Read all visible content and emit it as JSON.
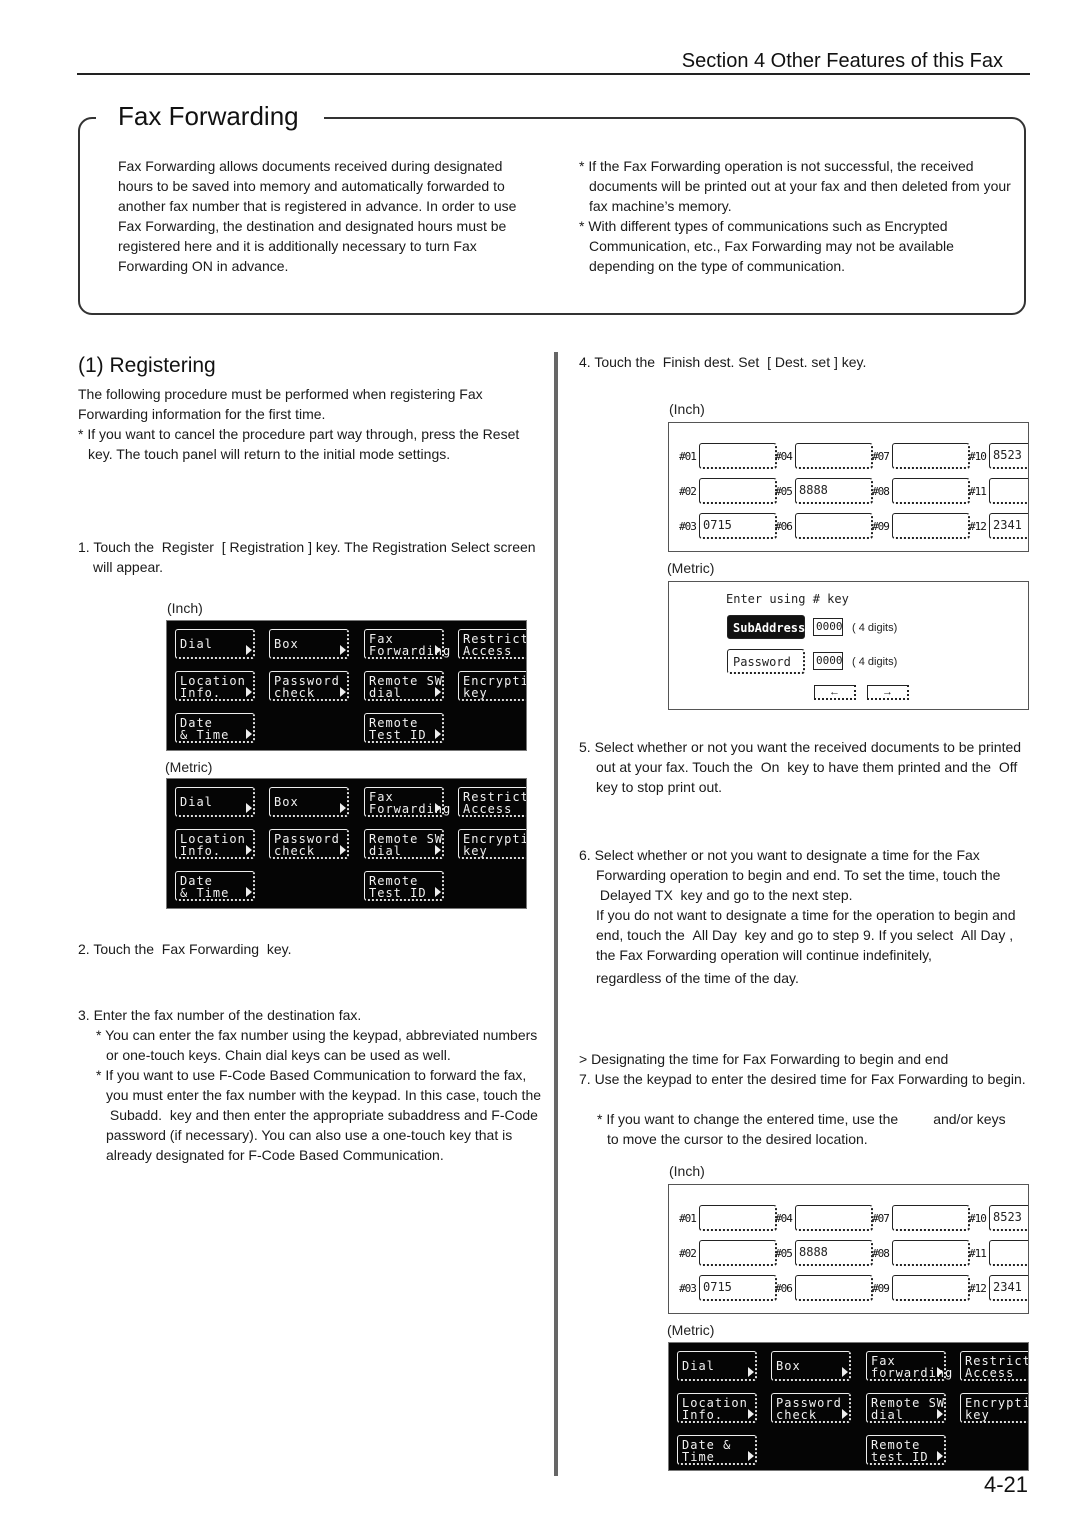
{
  "header": {
    "section_title": "Section 4 Other Features of this Fax"
  },
  "intro": {
    "title": "Fax Forwarding",
    "left_text": "Fax Forwarding allows documents received during designated hours to be saved into memory and automatically forwarded to another fax number that is registered in advance. In order to use Fax Forwarding, the destination and designated hours must be registered here and it is additionally necessary to turn Fax Forwarding ON in advance.",
    "notes": [
      "* If the Fax Forwarding operation is not successful, the received documents will be printed out at your fax and then deleted from your fax machine’s memory.",
      "* With different types of communications such as Encrypted Communication, etc., Fax Forwarding may not be available depending on the type of communication."
    ]
  },
  "registering": {
    "heading": "(1) Registering",
    "lead": "The following procedure must be performed when registering Fax Forwarding information for the first time.",
    "cancel_note": "* If you want to cancel the procedure part way through, press the Reset key. The touch panel will return to the initial mode settings.",
    "step1": "1. Touch the  Register  [ Registration ] key. The Registration Select screen will appear.",
    "step2": "2. Touch the  Fax Forwarding  key.",
    "step3": "3. Enter the fax number of the destination fax.",
    "step3_notes": [
      "* You can enter the fax number using the keypad, abbreviated numbers or one-touch keys. Chain dial keys can be used as well.",
      "* If you want to use F-Code Based Communication to forward the fax, you must enter the fax number with the keypad. In this case, touch the  Subadd.  key and then enter the appropriate subaddress and F-Code password (if necessary). You can also use a one-touch key that is already designated for F-Code Based Communication."
    ],
    "step4": "4. Touch the  Finish dest. Set  [ Dest. set ] key.",
    "step5": "5. Select whether or not you want the received documents to be printed out at your fax. Touch the  On  key to have them printed and the  Off  key to stop print out.",
    "step6a": "6. Select whether or not you want to designate a time for the Fax Forwarding operation to begin and end. To set the time, touch the  Delayed TX  key and go to the next step.",
    "step6b": "If you do not want to designate a time for the operation to begin and end, touch the  All Day  key and go to step 9. If you select  All Day , the Fax Forwarding operation will continue indefinitely,",
    "step6c": "regardless of the time of the day.",
    "subheading": "> Designating the time for Fax Forwarding to begin and end",
    "step7": "7. Use the keypad to enter the desired time for Fax Forwarding to begin.",
    "step7_note": "* If you want to change the entered time, use the         and/or keys to move the cursor to the desired location."
  },
  "captions": {
    "inch": "(Inch)",
    "metric": "(Metric)"
  },
  "menu_inch": [
    {
      "label": "Dial"
    },
    {
      "label": "Box"
    },
    {
      "label": "Fax\nForwarding"
    },
    {
      "label": "Restricted\nAccess"
    },
    {
      "label": "Location\nInfo."
    },
    {
      "label": "Password\ncheck"
    },
    {
      "label": "Remote SW\ndial"
    },
    {
      "label": "Encryption\nkey"
    },
    {
      "label": "Date\n& Time"
    },
    {
      "label": "Remote\nTest ID"
    }
  ],
  "menu_metric": [
    {
      "label": "Dial"
    },
    {
      "label": "Box"
    },
    {
      "label": "Fax\nForwarding"
    },
    {
      "label": "Restricted\nAccess"
    },
    {
      "label": "Location\nInfo."
    },
    {
      "label": "Password\ncheck"
    },
    {
      "label": "Remote SW\ndial"
    },
    {
      "label": "Encryption\nkey"
    },
    {
      "label": "Date\n& Time"
    },
    {
      "label": "Remote\nTest ID"
    }
  ],
  "menu_metric2": [
    {
      "label": "Dial"
    },
    {
      "label": "Box"
    },
    {
      "label": "Fax\nforwarding"
    },
    {
      "label": "Restricted\nAccess"
    },
    {
      "label": "Location\nInfo."
    },
    {
      "label": "Password\ncheck"
    },
    {
      "label": "Remote SW\ndial"
    },
    {
      "label": "Encryption\nkey"
    },
    {
      "label": "Date &\nTime"
    },
    {
      "label": "Remote\ntest ID"
    }
  ],
  "slots": [
    {
      "label": "#01",
      "value": ""
    },
    {
      "label": "#02",
      "value": ""
    },
    {
      "label": "#03",
      "value": "0715"
    },
    {
      "label": "#04",
      "value": ""
    },
    {
      "label": "#05",
      "value": "8888"
    },
    {
      "label": "#06",
      "value": ""
    },
    {
      "label": "#07",
      "value": ""
    },
    {
      "label": "#08",
      "value": ""
    },
    {
      "label": "#09",
      "value": ""
    },
    {
      "label": "#10",
      "value": "8523"
    },
    {
      "label": "#11",
      "value": ""
    },
    {
      "label": "#12",
      "value": "2341"
    }
  ],
  "subaddress_screen": {
    "prompt": "Enter using # key",
    "subaddress_label": "SubAddress",
    "subaddress_value": "0000",
    "password_label": "Password",
    "password_value": "0000",
    "digits_note": "( 4 digits)",
    "left_arrow": "←",
    "right_arrow": "→"
  },
  "footer": {
    "page_number": "4-21"
  }
}
